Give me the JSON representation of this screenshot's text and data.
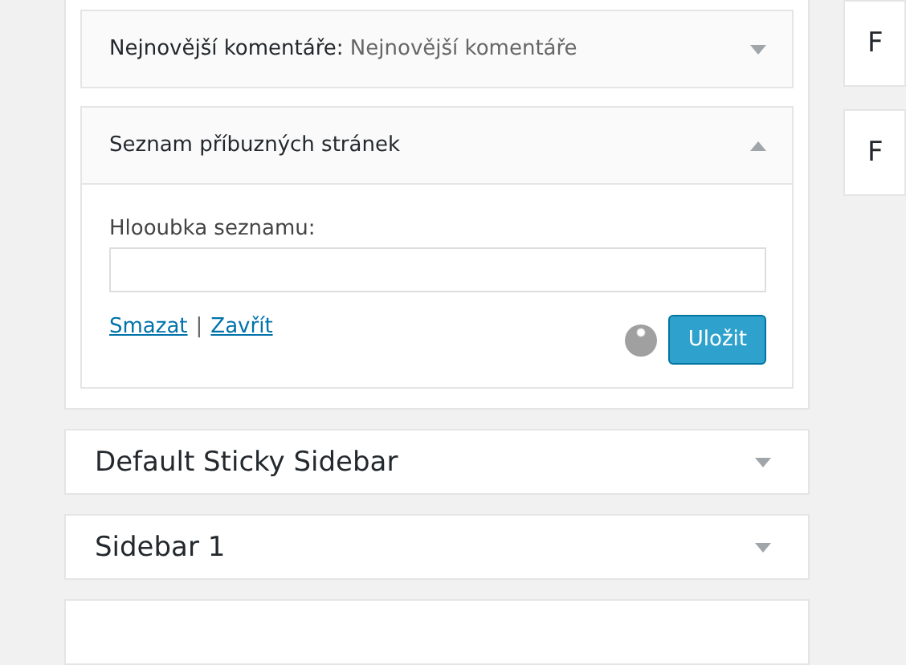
{
  "widgets": [
    {
      "title": "Nejnovější komentáře:",
      "subtitle": "Nejnovější komentáře",
      "expanded": false
    },
    {
      "title": "Seznam příbuzných stránek",
      "expanded": true,
      "form": {
        "label": "Hlooubka seznamu:",
        "links": [
          "Smazat",
          "Zavřít"
        ],
        "separator": "|",
        "save": "Uložit"
      }
    }
  ],
  "sidebars": [
    {
      "title": "Default Sticky Sidebar",
      "expanded": false
    },
    {
      "title": "Sidebar 1",
      "expanded": false
    }
  ],
  "right_cards": [
    {
      "label": "F"
    },
    {
      "label": "F"
    }
  ]
}
